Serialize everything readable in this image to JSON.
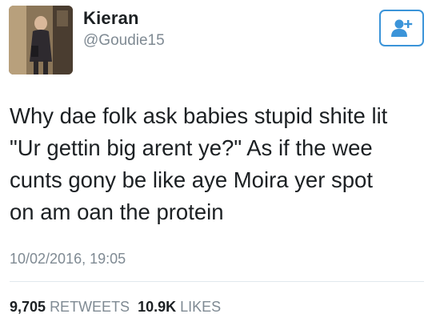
{
  "user": {
    "display_name": "Kieran",
    "handle": "@Goudie15"
  },
  "follow_button": {
    "icon": "add-user-icon",
    "color": "#3b94d9"
  },
  "tweet": {
    "text": "Why dae folk ask babies stupid shite lit\n\"Ur gettin big arent ye?\" As if the wee\ncunts gony be like aye Moira yer spot\non am oan the protein",
    "timestamp": "10/02/2016, 19:05"
  },
  "stats": {
    "retweets_count": "9,705",
    "retweets_label": "RETWEETS",
    "likes_count": "10.9K",
    "likes_label": "LIKES"
  }
}
